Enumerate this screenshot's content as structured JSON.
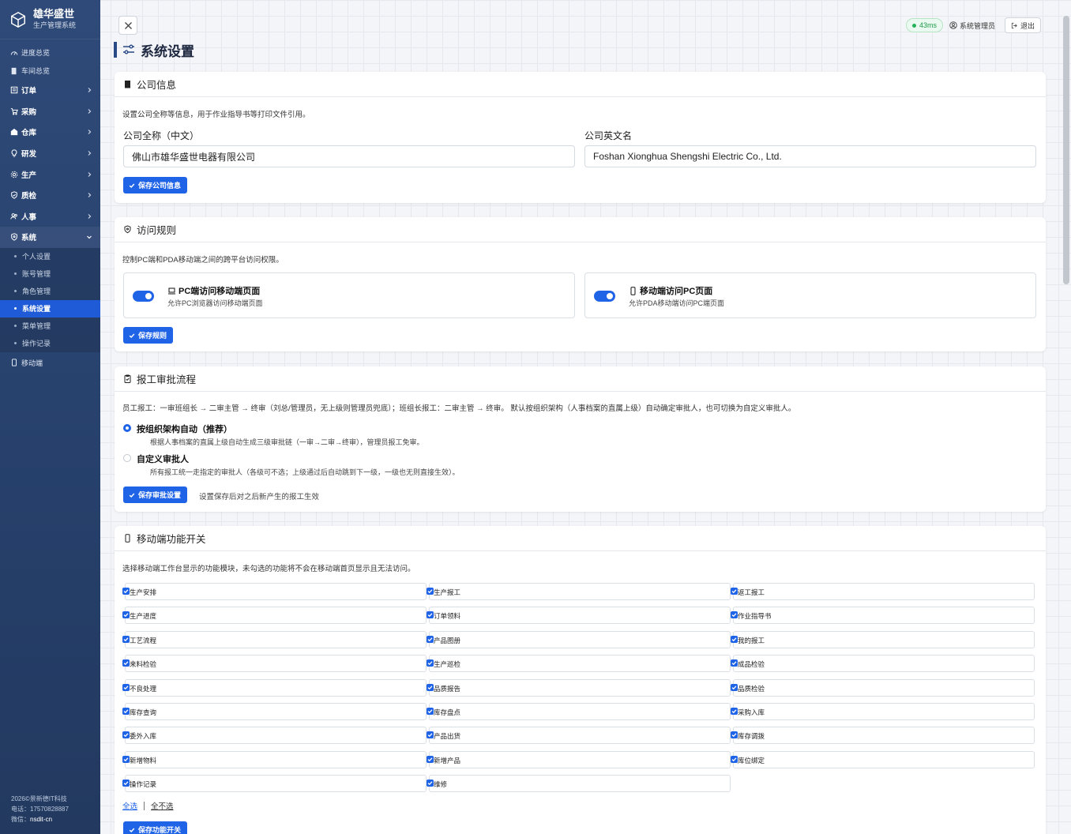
{
  "app": {
    "name": "雄华盛世",
    "subtitle": "生产管理系统"
  },
  "sidebar": {
    "top_items": [
      {
        "label": "进度总览",
        "icon": "gauge-icon"
      },
      {
        "label": "车间总览",
        "icon": "building-icon"
      }
    ],
    "groups": [
      {
        "label": "订单",
        "icon": "order-icon"
      },
      {
        "label": "采购",
        "icon": "cart-icon"
      },
      {
        "label": "仓库",
        "icon": "warehouse-icon"
      },
      {
        "label": "研发",
        "icon": "bulb-icon"
      },
      {
        "label": "生产",
        "icon": "gear-icon"
      },
      {
        "label": "质检",
        "icon": "shield-check-icon"
      },
      {
        "label": "人事",
        "icon": "users-icon"
      },
      {
        "label": "系统",
        "icon": "shield-icon"
      }
    ],
    "system_sub": [
      "个人设置",
      "账号管理",
      "角色管理",
      "系统设置",
      "菜单管理",
      "操作记录"
    ],
    "active_sub": "系统设置",
    "bottom_item": {
      "label": "移动端",
      "icon": "mobile-icon"
    },
    "footer": {
      "copyright": "2026©景新德IT科技",
      "phone": "电话：17570828887",
      "wechat_label": "微信：",
      "wechat": "nsdit-cn"
    }
  },
  "topbar": {
    "latency": "43ms",
    "user": "系统管理员",
    "logout": "退出"
  },
  "page": {
    "title": "系统设置"
  },
  "company": {
    "title": "公司信息",
    "desc": "设置公司全称等信息，用于作业指导书等打印文件引用。",
    "cn_label": "公司全称（中文）",
    "cn_value": "佛山市雄华盛世电器有限公司",
    "en_label": "公司英文名",
    "en_value": "Foshan Xionghua Shengshi Electric Co., Ltd.",
    "save": "保存公司信息"
  },
  "access": {
    "title": "访问规则",
    "desc": "控制PC端和PDA移动端之间的跨平台访问权限。",
    "pc_title": "PC端访问移动端页面",
    "pc_desc": "允许PC浏览器访问移动端页面",
    "pc_on": true,
    "mobile_title": "移动端访问PC页面",
    "mobile_desc": "允许PDA移动端访问PC端页面",
    "mobile_on": true,
    "save": "保存规则"
  },
  "approval": {
    "title": "报工审批流程",
    "desc": "员工报工：一审班组长 → 二审主管 → 终审（刘总/管理员，无上级则管理员兜底）；班组长报工：二审主管 → 终审。 默认按组织架构（人事档案的直属上级）自动确定审批人，也可切换为自定义审批人。",
    "opt1_title": "按组织架构自动（推荐）",
    "opt1_desc": "根据人事档案的直属上级自动生成三级审批链（一审→二审→终审），管理员报工免审。",
    "opt2_title": "自定义审批人",
    "opt2_desc": "所有报工统一走指定的审批人（各级可不选；上级通过后自动跳到下一级，一级也无则直接生效）。",
    "selected": 1,
    "save": "保存审批设置",
    "hint": "设置保存后对之后新产生的报工生效"
  },
  "mobile_features": {
    "title": "移动端功能开关",
    "desc": "选择移动端工作台显示的功能模块，未勾选的功能将不会在移动端首页显示且无法访问。",
    "items": [
      "生产安排",
      "生产报工",
      "返工报工",
      "生产进度",
      "订单领料",
      "作业指导书",
      "工艺流程",
      "产品图册",
      "我的报工",
      "来料检验",
      "生产巡检",
      "成品检验",
      "不良处理",
      "品质报告",
      "品质检验",
      "库存查询",
      "库存盘点",
      "采购入库",
      "委外入库",
      "产品出货",
      "库存调拨",
      "新增物料",
      "新增产品",
      "库位绑定",
      "操作记录",
      "维修"
    ],
    "select_all": "全选",
    "select_none": "全不选",
    "save": "保存功能开关"
  },
  "colors": {
    "sidebar": "#2f4a78",
    "accent": "#1f63e6",
    "active": "#1f5bd6",
    "ok": "#22b35a"
  }
}
